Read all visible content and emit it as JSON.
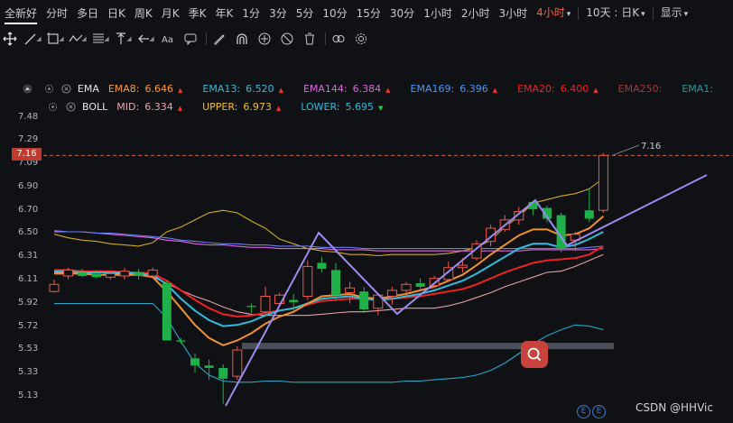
{
  "timeframes": {
    "items": [
      "全新好",
      "分时",
      "多日",
      "日K",
      "周K",
      "月K",
      "季K",
      "年K",
      "1分",
      "3分",
      "5分",
      "10分",
      "15分",
      "30分",
      "1小时",
      "2小时",
      "3小时"
    ],
    "selected": "4小时",
    "combo": "10天 : 日K",
    "display": "显示"
  },
  "indicators": {
    "ema": {
      "name": "EMA",
      "items": [
        {
          "label": "EMA8:",
          "value": "6.646",
          "color": "#ff9933",
          "arrow": "▲"
        },
        {
          "label": "EMA13:",
          "value": "6.520",
          "color": "#33bbdd",
          "arrow": "▲"
        },
        {
          "label": "EMA144:",
          "value": "6.384",
          "color": "#dd66dd",
          "arrow": "▲"
        },
        {
          "label": "EMA169:",
          "value": "6.396",
          "color": "#4499ff",
          "arrow": "▲"
        },
        {
          "label": "EMA20:",
          "value": "6.400",
          "color": "#ee2222",
          "arrow": "▲"
        },
        {
          "label": "EMA250:",
          "value": "",
          "color": "#a03a3a",
          "arrow": ""
        },
        {
          "label": "EMA1:",
          "value": "",
          "color": "#2a9a9a",
          "arrow": ""
        }
      ]
    },
    "boll": {
      "name": "BOLL",
      "items": [
        {
          "label": "MID:",
          "value": "6.334",
          "color": "#f0a0b0",
          "arrow": "▲",
          "arrowColor": "#ee3333"
        },
        {
          "label": "UPPER:",
          "value": "6.973",
          "color": "#f0c020",
          "arrow": "▲",
          "arrowColor": "#ee3333"
        },
        {
          "label": "LOWER:",
          "value": "5.695",
          "color": "#33bbdd",
          "arrow": "▼",
          "arrowColor": "#22cc55"
        }
      ]
    }
  },
  "axis": {
    "labels": [
      "7.48",
      "7.29",
      "7.09",
      "6.90",
      "6.70",
      "6.50",
      "6.31",
      "6.11",
      "5.92",
      "5.72",
      "5.53",
      "5.33",
      "5.13"
    ]
  },
  "price": {
    "current": "7.16",
    "label": "7.16"
  },
  "watermark": "CSDN @HHVic",
  "colors": {
    "up": "#f05a4a",
    "down": "#1fb04a",
    "bg": "#101114"
  },
  "chart_data": {
    "type": "candlestick",
    "ylim": [
      5.05,
      7.55
    ],
    "candles": [
      {
        "o": 6.02,
        "h": 6.12,
        "l": 6.01,
        "c": 6.08
      },
      {
        "o": 6.15,
        "h": 6.22,
        "l": 6.12,
        "c": 6.2
      },
      {
        "o": 6.18,
        "h": 6.21,
        "l": 6.14,
        "c": 6.15
      },
      {
        "o": 6.17,
        "h": 6.2,
        "l": 6.13,
        "c": 6.14
      },
      {
        "o": 6.14,
        "h": 6.19,
        "l": 6.12,
        "c": 6.17
      },
      {
        "o": 6.15,
        "h": 6.22,
        "l": 6.12,
        "c": 6.19
      },
      {
        "o": 6.18,
        "h": 6.21,
        "l": 6.12,
        "c": 6.15
      },
      {
        "o": 6.15,
        "h": 6.22,
        "l": 6.13,
        "c": 6.2
      },
      {
        "o": 6.09,
        "h": 6.11,
        "l": 5.61,
        "c": 5.61
      },
      {
        "o": 5.61,
        "h": 5.63,
        "l": 5.58,
        "c": 5.6
      },
      {
        "o": 5.46,
        "h": 5.5,
        "l": 5.34,
        "c": 5.4
      },
      {
        "o": 5.4,
        "h": 5.45,
        "l": 5.28,
        "c": 5.38
      },
      {
        "o": 5.38,
        "h": 5.41,
        "l": 5.08,
        "c": 5.29
      },
      {
        "o": 5.31,
        "h": 5.56,
        "l": 5.28,
        "c": 5.53
      },
      {
        "o": 5.9,
        "h": 5.92,
        "l": 5.84,
        "c": 5.89
      },
      {
        "o": 5.85,
        "h": 6.06,
        "l": 5.82,
        "c": 5.98
      },
      {
        "o": 5.92,
        "h": 6.01,
        "l": 5.9,
        "c": 5.99
      },
      {
        "o": 5.95,
        "h": 6.0,
        "l": 5.86,
        "c": 5.93
      },
      {
        "o": 5.98,
        "h": 6.28,
        "l": 5.95,
        "c": 6.23
      },
      {
        "o": 6.26,
        "h": 6.31,
        "l": 6.18,
        "c": 6.21
      },
      {
        "o": 6.2,
        "h": 6.26,
        "l": 5.94,
        "c": 5.99
      },
      {
        "o": 6.01,
        "h": 6.1,
        "l": 5.92,
        "c": 6.05
      },
      {
        "o": 6.02,
        "h": 6.06,
        "l": 5.84,
        "c": 5.87
      },
      {
        "o": 5.88,
        "h": 5.99,
        "l": 5.82,
        "c": 5.99
      },
      {
        "o": 5.98,
        "h": 6.06,
        "l": 5.91,
        "c": 6.03
      },
      {
        "o": 6.03,
        "h": 6.1,
        "l": 5.98,
        "c": 6.08
      },
      {
        "o": 6.09,
        "h": 6.13,
        "l": 6.04,
        "c": 6.06
      },
      {
        "o": 6.07,
        "h": 6.15,
        "l": 6.05,
        "c": 6.13
      },
      {
        "o": 6.12,
        "h": 6.27,
        "l": 6.1,
        "c": 6.22
      },
      {
        "o": 6.22,
        "h": 6.3,
        "l": 6.18,
        "c": 6.24
      },
      {
        "o": 6.3,
        "h": 6.45,
        "l": 6.28,
        "c": 6.42
      },
      {
        "o": 6.44,
        "h": 6.58,
        "l": 6.4,
        "c": 6.55
      },
      {
        "o": 6.54,
        "h": 6.66,
        "l": 6.52,
        "c": 6.62
      },
      {
        "o": 6.62,
        "h": 6.73,
        "l": 6.58,
        "c": 6.69
      },
      {
        "o": 6.77,
        "h": 6.78,
        "l": 6.66,
        "c": 6.71
      },
      {
        "o": 6.72,
        "h": 6.74,
        "l": 6.6,
        "c": 6.63
      },
      {
        "o": 6.66,
        "h": 6.68,
        "l": 6.35,
        "c": 6.38
      },
      {
        "o": 6.45,
        "h": 6.52,
        "l": 6.36,
        "c": 6.5
      },
      {
        "o": 6.7,
        "h": 6.88,
        "l": 6.6,
        "c": 6.63
      },
      {
        "o": 6.7,
        "h": 7.18,
        "l": 6.68,
        "c": 7.16
      }
    ],
    "series": [
      {
        "name": "BOLL UPPER",
        "color": "#d4a820",
        "values": [
          6.5,
          6.47,
          6.45,
          6.44,
          6.42,
          6.41,
          6.4,
          6.43,
          6.52,
          6.56,
          6.62,
          6.68,
          6.7,
          6.68,
          6.61,
          6.55,
          6.46,
          6.42,
          6.38,
          6.36,
          6.35,
          6.33,
          6.33,
          6.32,
          6.33,
          6.33,
          6.33,
          6.33,
          6.34,
          6.36,
          6.39,
          6.45,
          6.56,
          6.65,
          6.76,
          6.79,
          6.82,
          6.84,
          6.88,
          6.97
        ]
      },
      {
        "name": "EMA144",
        "color": "#dd66dd",
        "values": [
          6.52,
          6.52,
          6.52,
          6.51,
          6.5,
          6.49,
          6.48,
          6.47,
          6.45,
          6.44,
          6.42,
          6.41,
          6.41,
          6.4,
          6.39,
          6.39,
          6.38,
          6.38,
          6.38,
          6.38,
          6.37,
          6.37,
          6.37,
          6.36,
          6.36,
          6.36,
          6.36,
          6.36,
          6.36,
          6.36,
          6.36,
          6.36,
          6.36,
          6.36,
          6.37,
          6.37,
          6.37,
          6.37,
          6.37,
          6.38
        ]
      },
      {
        "name": "EMA169",
        "color": "#6a7cf5",
        "values": [
          6.53,
          6.52,
          6.52,
          6.51,
          6.51,
          6.5,
          6.49,
          6.48,
          6.47,
          6.45,
          6.44,
          6.43,
          6.42,
          6.42,
          6.41,
          6.41,
          6.4,
          6.4,
          6.4,
          6.39,
          6.39,
          6.39,
          6.38,
          6.38,
          6.38,
          6.38,
          6.38,
          6.38,
          6.38,
          6.38,
          6.38,
          6.38,
          6.38,
          6.38,
          6.38,
          6.38,
          6.38,
          6.38,
          6.39,
          6.4
        ]
      },
      {
        "name": "BOLL LOWER",
        "color": "#22aacc",
        "values": [
          5.92,
          5.92,
          5.92,
          5.92,
          5.92,
          5.92,
          5.92,
          5.92,
          5.8,
          5.6,
          5.42,
          5.32,
          5.27,
          5.26,
          5.26,
          5.27,
          5.27,
          5.26,
          5.26,
          5.26,
          5.26,
          5.26,
          5.26,
          5.26,
          5.26,
          5.27,
          5.27,
          5.28,
          5.29,
          5.3,
          5.32,
          5.36,
          5.42,
          5.5,
          5.58,
          5.65,
          5.7,
          5.74,
          5.73,
          5.7
        ]
      },
      {
        "name": "BOLL MID",
        "color": "#e8a0a8",
        "values": [
          6.18,
          6.18,
          6.18,
          6.18,
          6.17,
          6.17,
          6.16,
          6.14,
          6.09,
          6.03,
          5.98,
          5.94,
          5.89,
          5.85,
          5.83,
          5.82,
          5.82,
          5.82,
          5.82,
          5.83,
          5.84,
          5.85,
          5.85,
          5.86,
          5.87,
          5.88,
          5.88,
          5.88,
          5.9,
          5.93,
          5.97,
          6.01,
          6.06,
          6.1,
          6.14,
          6.18,
          6.19,
          6.23,
          6.28,
          6.33
        ]
      },
      {
        "name": "EMA20",
        "color": "#ee2222",
        "values": [
          6.2,
          6.2,
          6.19,
          6.19,
          6.19,
          6.18,
          6.18,
          6.17,
          6.11,
          6.03,
          5.95,
          5.88,
          5.83,
          5.81,
          5.82,
          5.84,
          5.86,
          5.88,
          5.91,
          5.94,
          5.95,
          5.96,
          5.96,
          5.96,
          5.96,
          5.97,
          5.98,
          6.0,
          6.02,
          6.04,
          6.08,
          6.13,
          6.18,
          6.22,
          6.26,
          6.28,
          6.29,
          6.3,
          6.33,
          6.4
        ]
      },
      {
        "name": "EMA13",
        "color": "#33bbdd",
        "values": [
          6.19,
          6.19,
          6.18,
          6.18,
          6.18,
          6.18,
          6.17,
          6.16,
          6.08,
          5.96,
          5.86,
          5.78,
          5.73,
          5.74,
          5.77,
          5.82,
          5.86,
          5.88,
          5.92,
          5.96,
          5.97,
          5.98,
          5.96,
          5.95,
          5.96,
          5.98,
          6.0,
          6.03,
          6.07,
          6.11,
          6.17,
          6.24,
          6.31,
          6.38,
          6.42,
          6.42,
          6.39,
          6.41,
          6.46,
          6.52
        ]
      },
      {
        "name": "EMA8",
        "color": "#f09030",
        "values": [
          6.17,
          6.17,
          6.17,
          6.16,
          6.16,
          6.16,
          6.16,
          6.14,
          6.02,
          5.88,
          5.74,
          5.63,
          5.57,
          5.61,
          5.67,
          5.75,
          5.81,
          5.85,
          5.92,
          5.98,
          5.99,
          6.0,
          5.97,
          5.96,
          5.98,
          6.0,
          6.03,
          6.06,
          6.11,
          6.16,
          6.24,
          6.33,
          6.41,
          6.49,
          6.54,
          6.54,
          6.49,
          6.5,
          6.55,
          6.65
        ]
      }
    ]
  }
}
